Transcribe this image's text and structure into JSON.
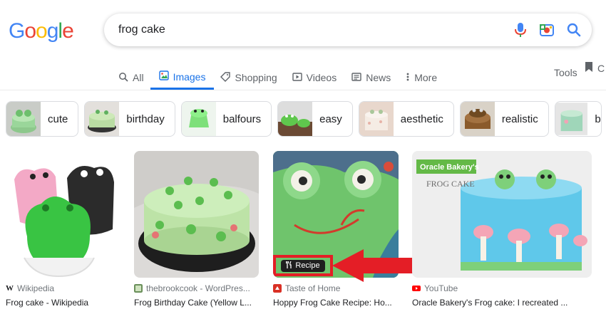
{
  "logo": {
    "letters": [
      "G",
      "o",
      "o",
      "g",
      "l",
      "e"
    ],
    "colors": [
      "#4285F4",
      "#EA4335",
      "#FBBC05",
      "#4285F4",
      "#34A853",
      "#EA4335"
    ]
  },
  "search": {
    "query": "frog cake"
  },
  "tabs": [
    {
      "label": "All",
      "icon": "search-icon"
    },
    {
      "label": "Images",
      "icon": "images-icon",
      "active": true
    },
    {
      "label": "Shopping",
      "icon": "tag-icon"
    },
    {
      "label": "Videos",
      "icon": "play-icon"
    },
    {
      "label": "News",
      "icon": "news-icon"
    },
    {
      "label": "More",
      "icon": "more-vert-icon"
    }
  ],
  "tools_label": "Tools",
  "saved_label": "C",
  "chips": [
    {
      "label": "cute"
    },
    {
      "label": "birthday"
    },
    {
      "label": "balfours"
    },
    {
      "label": "easy"
    },
    {
      "label": "aesthetic"
    },
    {
      "label": "realistic"
    },
    {
      "label": "b"
    }
  ],
  "results": [
    {
      "source": "Wikipedia",
      "title": "Frog cake - Wikipedia",
      "icon": "wikipedia-icon"
    },
    {
      "source": "thebrookcook - WordPres...",
      "title": "Frog Birthday Cake (Yellow L...",
      "icon": "site-favicon"
    },
    {
      "source": "Taste of Home",
      "title": "Hoppy Frog Cake Recipe: Ho...",
      "icon": "taste-of-home-icon",
      "badge": "Recipe"
    },
    {
      "source": "YouTube",
      "title": "Oracle Bakery's Frog cake: I recreated ...",
      "icon": "youtube-icon",
      "overlay_title": "Oracle Bakery's",
      "overlay_sub": "FROG CAKE"
    }
  ],
  "colors": {
    "accent": "#1a73e8",
    "highlight": "#e41e26"
  }
}
